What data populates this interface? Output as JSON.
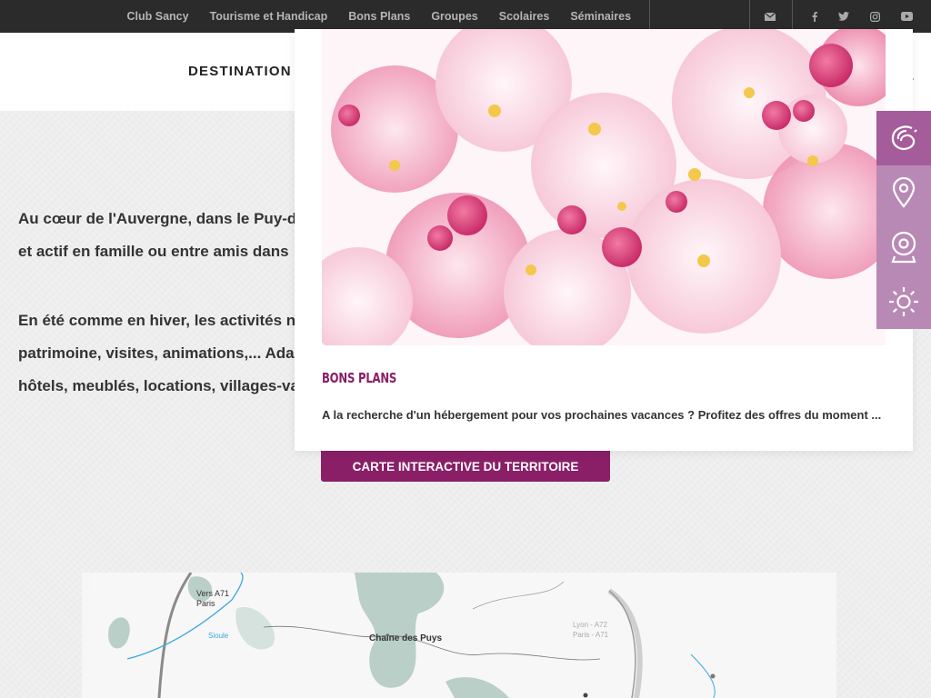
{
  "top_nav": {
    "links": [
      "Club Sancy",
      "Tourisme et Handicap",
      "Bons Plans",
      "Groupes",
      "Scolaires",
      "Séminaires"
    ],
    "icons": [
      "envelope-icon",
      "facebook-icon",
      "twitter-icon",
      "instagram-icon",
      "youtube-icon"
    ]
  },
  "header": {
    "nav_label": "DESTINATION"
  },
  "content": {
    "paragraph1": [
      "Au cœur de l'Auvergne, dans le Puy-de",
      "et actif en famille ou entre amis dans"
    ],
    "paragraph2": [
      "En été comme en hiver, les activités ne",
      "patrimoine, visites, animations,... Adap",
      "hôtels, meublés, locations, villages-va"
    ],
    "cta_label": "CARTE INTERACTIVE DU TERRITOIRE"
  },
  "dropdown_card": {
    "image_icon": "cherry-blossom-photo",
    "title": "BONS PLANS",
    "description": "A la recherche d'un hébergement pour vos prochaines vacances ? Profitez des offres du moment ..."
  },
  "map": {
    "labels": [
      "Vers A71",
      "Paris",
      "Sioule",
      "Chaîne des Puys",
      "Lyon - A72",
      "Paris - A71"
    ]
  },
  "sidebar": {
    "icons": [
      "brand-logo-icon",
      "map-pin-icon",
      "webcam-icon",
      "sun-icon"
    ]
  },
  "colors": {
    "accent": "#8a1f68",
    "sidebar": "#b989b5",
    "sidebar_active": "#a55c9a",
    "topbar": "#2b2b2b"
  }
}
